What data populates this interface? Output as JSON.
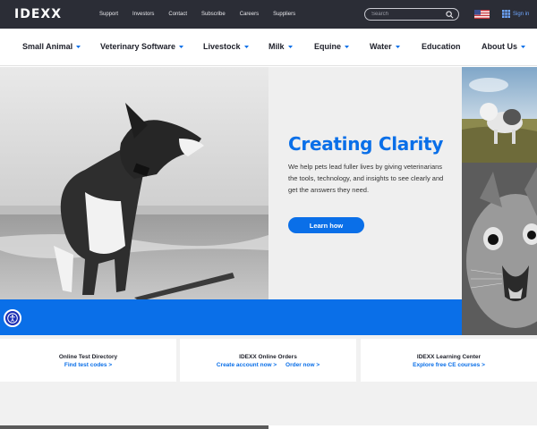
{
  "brand": {
    "logo_text": "IDEXX"
  },
  "utility_nav": [
    "Support",
    "Investors",
    "Contact",
    "Subscribe",
    "Careers",
    "Suppliers"
  ],
  "search": {
    "placeholder": "Search"
  },
  "account": {
    "signin_label": "Sign in"
  },
  "main_nav": [
    {
      "label": "Small Animal",
      "has_menu": true
    },
    {
      "label": "Veterinary Software",
      "has_menu": true
    },
    {
      "label": "Livestock",
      "has_menu": true
    },
    {
      "label": "Milk",
      "has_menu": true
    },
    {
      "label": "Equine",
      "has_menu": true
    },
    {
      "label": "Water",
      "has_menu": true
    },
    {
      "label": "Education",
      "has_menu": false
    },
    {
      "label": "About Us",
      "has_menu": true
    }
  ],
  "hero": {
    "title": "Creating Clarity",
    "body": "We help pets lead fuller lives by giving veterinarians the tools, technology, and insights to see clearly and get the answers they need.",
    "cta_label": "Learn how"
  },
  "cards": [
    {
      "title": "Online Test Directory",
      "links": [
        "Find test codes >"
      ]
    },
    {
      "title": "IDEXX Online Orders",
      "links": [
        "Create account now >",
        "Order now >"
      ]
    },
    {
      "title": "IDEXX Learning Center",
      "links": [
        "Explore free CE courses >"
      ]
    }
  ],
  "colors": {
    "topbar": "#2b2d36",
    "accent": "#0a6fe8",
    "panel": "#efefef",
    "page_bg": "#f1f1f1"
  },
  "icons": {
    "search": "search-icon",
    "flag": "us-flag-icon",
    "signin": "grid-icon",
    "accessibility": "accessibility-icon"
  }
}
